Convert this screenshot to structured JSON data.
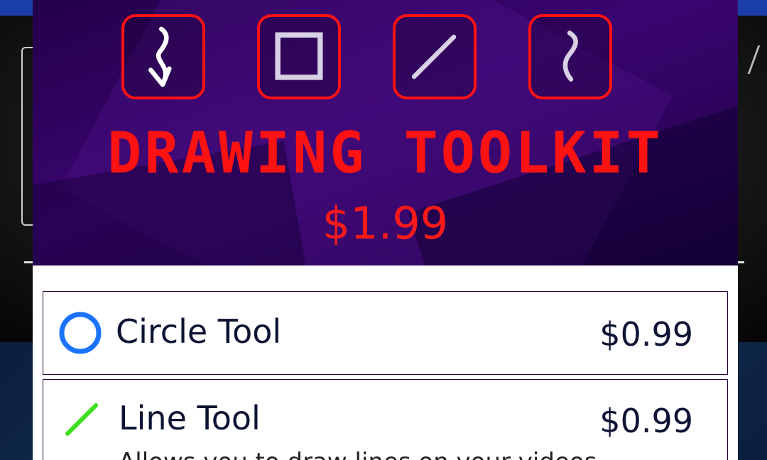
{
  "banner": {
    "title": "DRAWING TOOLKIT",
    "price": "$1.99",
    "icons": [
      "curved-arrow-icon",
      "square-icon",
      "line-icon",
      "curve-icon"
    ]
  },
  "items": [
    {
      "name": "Circle Tool",
      "price": "$0.99",
      "icon": "circle-icon",
      "icon_color": "#1a73ff"
    },
    {
      "name": "Line Tool",
      "price": "$0.99",
      "icon": "line-icon",
      "icon_color": "#3ee01c",
      "description": "Allows you to draw lines on your videos"
    }
  ],
  "colors": {
    "banner_accent": "#ff1212",
    "banner_background": "#2a0555",
    "item_border": "#24003c",
    "text": "#0d1433"
  }
}
